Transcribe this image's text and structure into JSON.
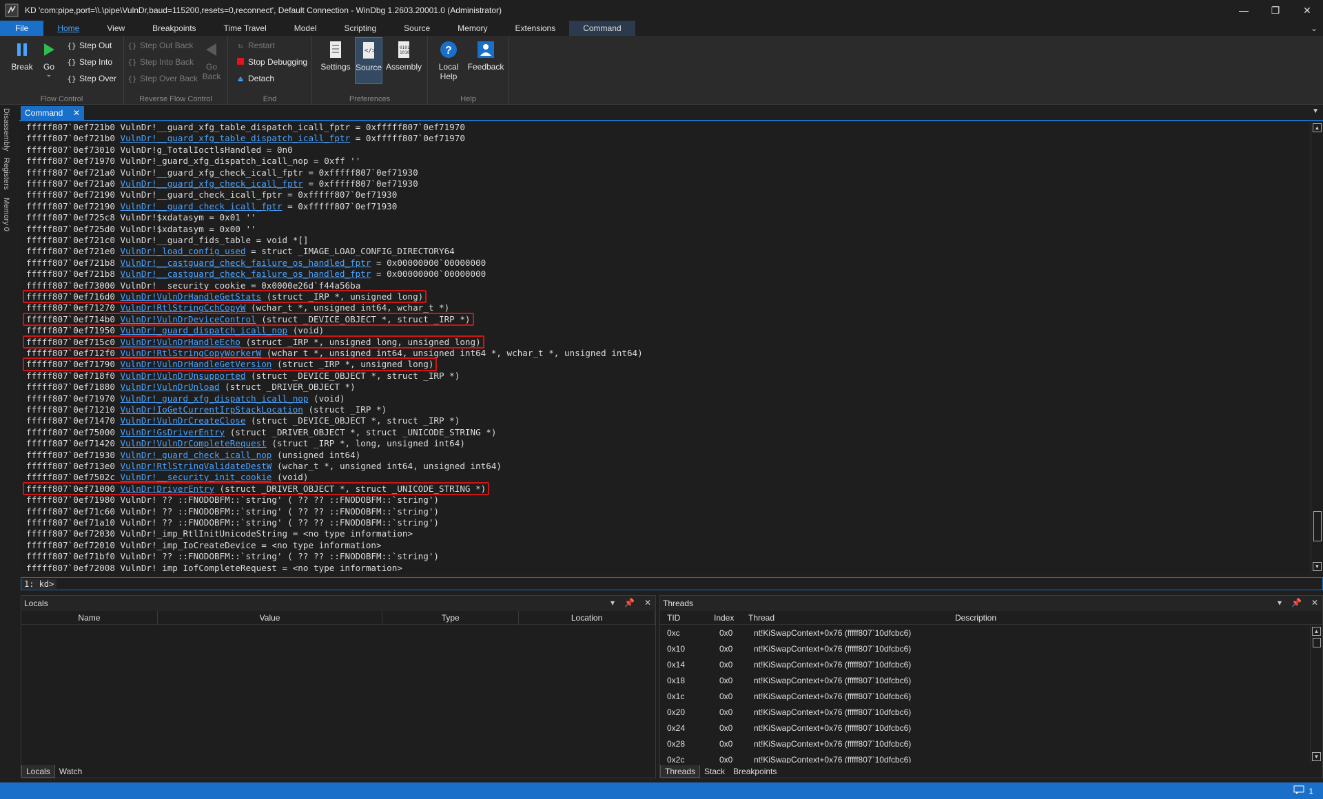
{
  "window": {
    "title": "KD 'com:pipe,port=\\\\.\\pipe\\VulnDr,baud=115200,resets=0,reconnect', Default Connection  - WinDbg 1.2603.20001.0 (Administrator)",
    "controls": {
      "minimize": "—",
      "restore": "❐",
      "close": "✕"
    }
  },
  "ribbon_tabs": [
    "File",
    "Home",
    "View",
    "Breakpoints",
    "Time Travel",
    "Model",
    "Scripting",
    "Source",
    "Memory",
    "Extensions",
    "Command"
  ],
  "ribbon": {
    "flow_control": {
      "label": "Flow Control",
      "break": "Break",
      "go": "Go",
      "step_out": "Step Out",
      "step_into": "Step Into",
      "step_over": "Step Over"
    },
    "reverse_flow_control": {
      "label": "Reverse Flow Control",
      "step_out_back": "Step Out Back",
      "step_into_back": "Step Into Back",
      "step_over_back": "Step Over Back",
      "go_back_1": "Go",
      "go_back_2": "Back"
    },
    "end": {
      "label": "End",
      "restart": "Restart",
      "stop_debugging": "Stop Debugging",
      "detach": "Detach"
    },
    "preferences": {
      "label": "Preferences",
      "settings": "Settings",
      "source": "Source",
      "assembly": "Assembly"
    },
    "help": {
      "label": "Help",
      "local_help_1": "Local",
      "local_help_2": "Help",
      "feedback": "Feedback"
    }
  },
  "side_tabs": [
    "Disassembly",
    "Registers",
    "Memory 0"
  ],
  "command_window": {
    "tab_label": "Command",
    "lines": [
      {
        "addr": "fffff807`0ef721b0",
        "mod": "VulnDr!",
        "sym": "",
        "plain": "__guard_xfg_table_dispatch_icall_fptr",
        "rest": " = 0xfffff807`0ef71970"
      },
      {
        "addr": "fffff807`0ef721b0",
        "mod": "",
        "sym": "VulnDr!__guard_xfg_table_dispatch_icall_fptr",
        "plain": "",
        "rest": " = 0xfffff807`0ef71970"
      },
      {
        "addr": "fffff807`0ef73010",
        "mod": "VulnDr!",
        "sym": "",
        "plain": "g_TotalIoctlsHandled",
        "rest": " = 0n0"
      },
      {
        "addr": "fffff807`0ef71970",
        "mod": "VulnDr!",
        "sym": "",
        "plain": "_guard_xfg_dispatch_icall_nop",
        "rest": " = 0xff ''"
      },
      {
        "addr": "fffff807`0ef721a0",
        "mod": "VulnDr!",
        "sym": "",
        "plain": "__guard_xfg_check_icall_fptr",
        "rest": " = 0xfffff807`0ef71930"
      },
      {
        "addr": "fffff807`0ef721a0",
        "mod": "",
        "sym": "VulnDr!__guard_xfg_check_icall_fptr",
        "plain": "",
        "rest": " = 0xfffff807`0ef71930"
      },
      {
        "addr": "fffff807`0ef72190",
        "mod": "VulnDr!",
        "sym": "",
        "plain": "__guard_check_icall_fptr",
        "rest": " = 0xfffff807`0ef71930"
      },
      {
        "addr": "fffff807`0ef72190",
        "mod": "",
        "sym": "VulnDr!__guard_check_icall_fptr",
        "plain": "",
        "rest": " = 0xfffff807`0ef71930"
      },
      {
        "addr": "fffff807`0ef725c8",
        "mod": "VulnDr!",
        "sym": "",
        "plain": "$xdatasym",
        "rest": " = 0x01 ''"
      },
      {
        "addr": "fffff807`0ef725d0",
        "mod": "VulnDr!",
        "sym": "",
        "plain": "$xdatasym",
        "rest": " = 0x00 ''"
      },
      {
        "addr": "fffff807`0ef721c0",
        "mod": "VulnDr!",
        "sym": "",
        "plain": "__guard_fids_table",
        "rest": " = void *[]"
      },
      {
        "addr": "fffff807`0ef721e0",
        "mod": "",
        "sym": "VulnDr!_load_config_used",
        "plain": "",
        "rest": " = struct _IMAGE_LOAD_CONFIG_DIRECTORY64"
      },
      {
        "addr": "fffff807`0ef721b8",
        "mod": "",
        "sym": "VulnDr!__castguard_check_failure_os_handled_fptr",
        "plain": "",
        "rest": " = 0x00000000`00000000"
      },
      {
        "addr": "fffff807`0ef721b8",
        "mod": "",
        "sym": "VulnDr!__castguard_check_failure_os_handled_fptr",
        "plain": "",
        "rest": " = 0x00000000`00000000"
      },
      {
        "addr": "fffff807`0ef73000",
        "mod": "VulnDr!",
        "sym": "",
        "plain": "__security_cookie",
        "rest": " = 0x0000e26d`f44a56ba"
      },
      {
        "addr": "fffff807`0ef716d0",
        "mod": "",
        "sym": "VulnDr!VulnDrHandleGetStats",
        "plain": "",
        "rest": " (struct _IRP *, unsigned long)"
      },
      {
        "addr": "fffff807`0ef71270",
        "mod": "",
        "sym": "VulnDr!RtlStringCchCopyW",
        "plain": "",
        "rest": " (wchar_t *, unsigned int64, wchar_t *)"
      },
      {
        "addr": "fffff807`0ef714b0",
        "mod": "",
        "sym": "VulnDr!VulnDrDeviceControl",
        "plain": "",
        "rest": " (struct _DEVICE_OBJECT *, struct _IRP *)"
      },
      {
        "addr": "fffff807`0ef71950",
        "mod": "",
        "sym": "VulnDr!_guard_dispatch_icall_nop",
        "plain": "",
        "rest": " (void)"
      },
      {
        "addr": "fffff807`0ef715c0",
        "mod": "",
        "sym": "VulnDr!VulnDrHandleEcho",
        "plain": "",
        "rest": " (struct _IRP *, unsigned long, unsigned long)"
      },
      {
        "addr": "fffff807`0ef712f0",
        "mod": "",
        "sym": "VulnDr!RtlStringCopyWorkerW",
        "plain": "",
        "rest": " (wchar_t *, unsigned int64, unsigned int64 *, wchar_t *, unsigned int64)"
      },
      {
        "addr": "fffff807`0ef71790",
        "mod": "",
        "sym": "VulnDr!VulnDrHandleGetVersion",
        "plain": "",
        "rest": " (struct _IRP *, unsigned long)"
      },
      {
        "addr": "fffff807`0ef718f0",
        "mod": "",
        "sym": "VulnDr!VulnDrUnsupported",
        "plain": "",
        "rest": " (struct _DEVICE_OBJECT *, struct _IRP *)"
      },
      {
        "addr": "fffff807`0ef71880",
        "mod": "",
        "sym": "VulnDr!VulnDrUnload",
        "plain": "",
        "rest": " (struct _DRIVER_OBJECT *)"
      },
      {
        "addr": "fffff807`0ef71970",
        "mod": "",
        "sym": "VulnDr!_guard_xfg_dispatch_icall_nop",
        "plain": "",
        "rest": " (void)"
      },
      {
        "addr": "fffff807`0ef71210",
        "mod": "",
        "sym": "VulnDr!IoGetCurrentIrpStackLocation",
        "plain": "",
        "rest": " (struct _IRP *)"
      },
      {
        "addr": "fffff807`0ef71470",
        "mod": "",
        "sym": "VulnDr!VulnDrCreateClose",
        "plain": "",
        "rest": " (struct _DEVICE_OBJECT *, struct _IRP *)"
      },
      {
        "addr": "fffff807`0ef75000",
        "mod": "",
        "sym": "VulnDr!GsDriverEntry",
        "plain": "",
        "rest": " (struct _DRIVER_OBJECT *, struct _UNICODE_STRING *)"
      },
      {
        "addr": "fffff807`0ef71420",
        "mod": "",
        "sym": "VulnDr!VulnDrCompleteRequest",
        "plain": "",
        "rest": " (struct _IRP *, long, unsigned int64)"
      },
      {
        "addr": "fffff807`0ef71930",
        "mod": "",
        "sym": "VulnDr!_guard_check_icall_nop",
        "plain": "",
        "rest": " (unsigned int64)"
      },
      {
        "addr": "fffff807`0ef713e0",
        "mod": "",
        "sym": "VulnDr!RtlStringValidateDestW",
        "plain": "",
        "rest": " (wchar_t *, unsigned int64, unsigned int64)"
      },
      {
        "addr": "fffff807`0ef7502c",
        "mod": "",
        "sym": "VulnDr!__security_init_cookie",
        "plain": "",
        "rest": " (void)"
      },
      {
        "addr": "fffff807`0ef71000",
        "mod": "",
        "sym": "VulnDr!DriverEntry",
        "plain": "",
        "rest": " (struct _DRIVER_OBJECT *, struct _UNICODE_STRING *)"
      },
      {
        "addr": "fffff807`0ef71980",
        "mod": "VulnDr!",
        "sym": "",
        "plain": " ?? ::FNODOBFM::`string'",
        "rest": " ( ?? ?? ::FNODOBFM::`string')"
      },
      {
        "addr": "fffff807`0ef71c60",
        "mod": "VulnDr!",
        "sym": "",
        "plain": " ?? ::FNODOBFM::`string'",
        "rest": " ( ?? ?? ::FNODOBFM::`string')"
      },
      {
        "addr": "fffff807`0ef71a10",
        "mod": "VulnDr!",
        "sym": "",
        "plain": " ?? ::FNODOBFM::`string'",
        "rest": " ( ?? ?? ::FNODOBFM::`string')"
      },
      {
        "addr": "fffff807`0ef72030",
        "mod": "VulnDr!",
        "sym": "",
        "plain": "_imp_RtlInitUnicodeString",
        "rest": " = <no type information>"
      },
      {
        "addr": "fffff807`0ef72010",
        "mod": "VulnDr!",
        "sym": "",
        "plain": "_imp_IoCreateDevice",
        "rest": " = <no type information>"
      },
      {
        "addr": "fffff807`0ef71bf0",
        "mod": "VulnDr!",
        "sym": "",
        "plain": " ?? ::FNODOBFM::`string'",
        "rest": " ( ?? ?? ::FNODOBFM::`string')"
      },
      {
        "addr": "fffff807`0ef72008",
        "mod": "VulnDr!",
        "sym": "",
        "plain": " imp IofCompleteRequest",
        "rest": " = <no type information>"
      }
    ],
    "highlighted": [
      "VulnDr!VulnDrHandleGetStats",
      "VulnDr!VulnDrDeviceControl",
      "VulnDr!VulnDrHandleEcho",
      "VulnDr!VulnDrHandleGetVersion",
      "VulnDr!DriverEntry"
    ],
    "prompt": "1: kd>",
    "input_value": ""
  },
  "locals_pane": {
    "title": "Locals",
    "columns": [
      "Name",
      "Value",
      "Type",
      "Location"
    ],
    "tabs": [
      "Locals",
      "Watch"
    ]
  },
  "threads_pane": {
    "title": "Threads",
    "columns": [
      "TID",
      "Index",
      "Thread",
      "Description"
    ],
    "rows": [
      {
        "tid": "0xc",
        "index": "0x0",
        "thread": "nt!KiSwapContext+0x76 (fffff807`10dfcbc6)"
      },
      {
        "tid": "0x10",
        "index": "0x0",
        "thread": "nt!KiSwapContext+0x76 (fffff807`10dfcbc6)"
      },
      {
        "tid": "0x14",
        "index": "0x0",
        "thread": "nt!KiSwapContext+0x76 (fffff807`10dfcbc6)"
      },
      {
        "tid": "0x18",
        "index": "0x0",
        "thread": "nt!KiSwapContext+0x76 (fffff807`10dfcbc6)"
      },
      {
        "tid": "0x1c",
        "index": "0x0",
        "thread": "nt!KiSwapContext+0x76 (fffff807`10dfcbc6)"
      },
      {
        "tid": "0x20",
        "index": "0x0",
        "thread": "nt!KiSwapContext+0x76 (fffff807`10dfcbc6)"
      },
      {
        "tid": "0x24",
        "index": "0x0",
        "thread": "nt!KiSwapContext+0x76 (fffff807`10dfcbc6)"
      },
      {
        "tid": "0x28",
        "index": "0x0",
        "thread": "nt!KiSwapContext+0x76 (fffff807`10dfcbc6)"
      },
      {
        "tid": "0x2c",
        "index": "0x0",
        "thread": "nt!KiSwapContext+0x76 (fffff807`10dfcbc6)"
      }
    ],
    "tabs": [
      "Threads",
      "Stack",
      "Breakpoints"
    ]
  },
  "status_bar": {
    "message_count": "1"
  },
  "colors": {
    "accent": "#1a6fc9",
    "link": "#4aa3ff",
    "highlight_box": "#d01515"
  }
}
